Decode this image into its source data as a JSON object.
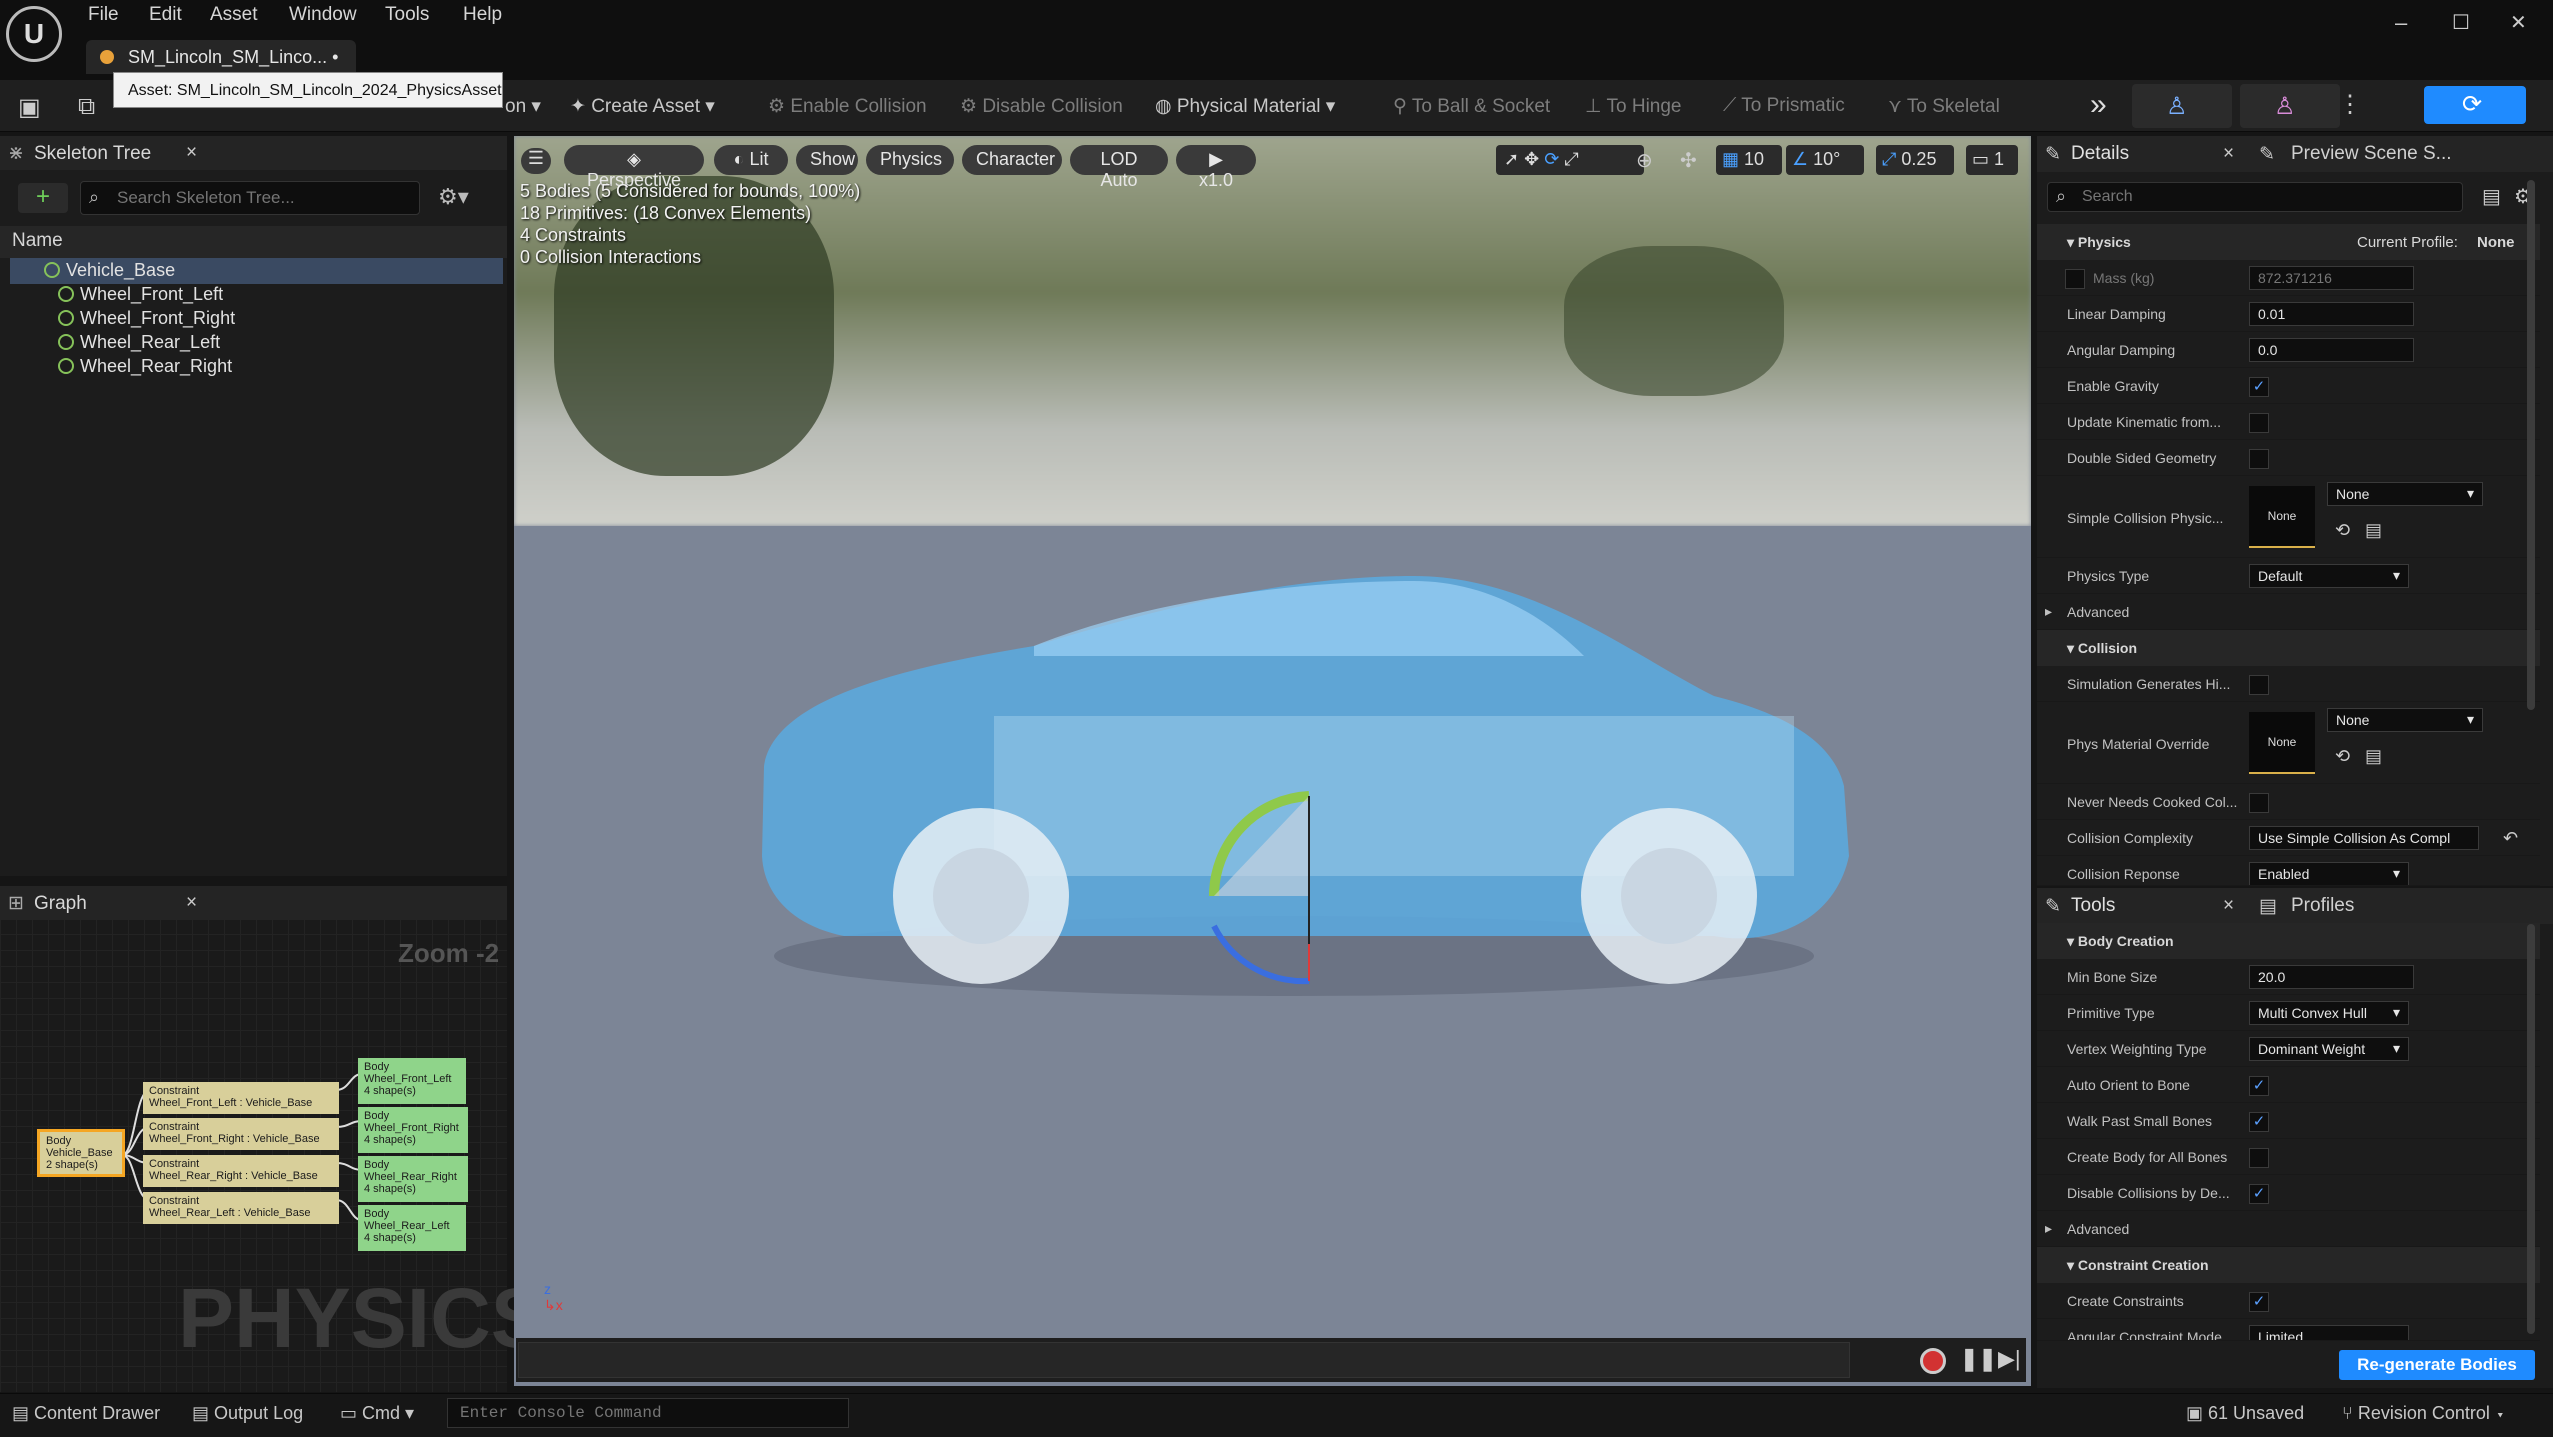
{
  "menu": {
    "file": "File",
    "edit": "Edit",
    "asset": "Asset",
    "window": "Window",
    "tools": "Tools",
    "help": "Help"
  },
  "tab": {
    "title": "SM_Lincoln_SM_Linco...",
    "marker": "•",
    "close": "×"
  },
  "tooltip": "Asset: SM_Lincoln_SM_Lincoln_2024_PhysicsAsset",
  "window_controls": {
    "minimize": "–",
    "maximize": "☐",
    "close": "✕"
  },
  "toolbar": {
    "partial_label": "on",
    "create_asset": "Create Asset",
    "enable_collision": "Enable Collision",
    "disable_collision": "Disable Collision",
    "physical_material": "Physical Material",
    "to_ball_socket": "To Ball & Socket",
    "to_hinge": "To Hinge",
    "to_prismatic": "To Prismatic",
    "to_skeletal": "To Skeletal"
  },
  "skeleton": {
    "panel_title": "Skeleton Tree",
    "search_placeholder": "Search Skeleton Tree...",
    "column_name": "Name",
    "bones": [
      "Vehicle_Base",
      "Wheel_Front_Left",
      "Wheel_Front_Right",
      "Wheel_Rear_Left",
      "Wheel_Rear_Right"
    ]
  },
  "graph": {
    "panel_title": "Graph",
    "zoom": "Zoom -2",
    "watermark": "PHYSICS",
    "root": [
      "Body",
      "Vehicle_Base",
      "2 shape(s)"
    ],
    "constraints": [
      [
        "Constraint",
        "Wheel_Front_Left : Vehicle_Base"
      ],
      [
        "Constraint",
        "Wheel_Front_Right : Vehicle_Base"
      ],
      [
        "Constraint",
        "Wheel_Rear_Right : Vehicle_Base"
      ],
      [
        "Constraint",
        "Wheel_Rear_Left : Vehicle_Base"
      ]
    ],
    "bodies": [
      [
        "Body",
        "Wheel_Front_Left",
        "4 shape(s)"
      ],
      [
        "Body",
        "Wheel_Front_Right",
        "4 shape(s)"
      ],
      [
        "Body",
        "Wheel_Rear_Right",
        "4 shape(s)"
      ],
      [
        "Body",
        "Wheel_Rear_Left",
        "4 shape(s)"
      ]
    ]
  },
  "viewport": {
    "perspective": "Perspective",
    "lit": "Lit",
    "show": "Show",
    "physics": "Physics",
    "character": "Character",
    "lod": "LOD Auto",
    "speed": "x1.0",
    "grid": "10",
    "angle": "10°",
    "scale": "0.25",
    "camera": "1",
    "stats": [
      "5 Bodies (5 Considered for bounds, 100%)",
      "18 Primitives: (18 Convex Elements)",
      "4 Constraints",
      "0 Collision Interactions"
    ]
  },
  "details": {
    "panel_title": "Details",
    "preview_tab": "Preview Scene S...",
    "search_placeholder": "Search",
    "physics_section": "Physics",
    "profile_label": "Current Profile:",
    "profile_value": "None",
    "mass_label": "Mass (kg)",
    "mass_value": "872.371216",
    "linear_damping_label": "Linear Damping",
    "linear_damping": "0.01",
    "angular_damping_label": "Angular Damping",
    "angular_damping": "0.0",
    "enable_gravity": "Enable Gravity",
    "update_kinematic": "Update Kinematic from...",
    "double_sided": "Double Sided Geometry",
    "simple_collision": "Simple Collision Physic...",
    "thumb_none": "None",
    "select_none": "None",
    "physics_type_label": "Physics Type",
    "physics_type": "Default",
    "advanced": "Advanced",
    "collision_section": "Collision",
    "sim_generates_hit": "Simulation Generates Hi...",
    "phys_material_override": "Phys Material Override",
    "never_needs_cooked": "Never Needs Cooked Col...",
    "collision_complexity_label": "Collision Complexity",
    "collision_complexity": "Use Simple Collision As Compl",
    "collision_response_label": "Collision Reponse",
    "collision_response": "Enabled"
  },
  "tools": {
    "panel_title": "Tools",
    "profiles_tab": "Profiles",
    "body_creation": "Body Creation",
    "min_bone_size_label": "Min Bone Size",
    "min_bone_size": "20.0",
    "primitive_type_label": "Primitive Type",
    "primitive_type": "Multi Convex Hull",
    "vertex_weighting_label": "Vertex Weighting Type",
    "vertex_weighting": "Dominant Weight",
    "auto_orient": "Auto Orient to Bone",
    "walk_past": "Walk Past Small Bones",
    "create_body_all": "Create Body for All Bones",
    "disable_collisions": "Disable Collisions by De...",
    "advanced": "Advanced",
    "constraint_creation": "Constraint Creation",
    "create_constraints": "Create Constraints",
    "angular_mode_label": "Angular Constraint Mode",
    "angular_mode": "Limited",
    "regenerate": "Re-generate Bodies"
  },
  "statusbar": {
    "content_drawer": "Content Drawer",
    "output_log": "Output Log",
    "cmd": "Cmd",
    "console_placeholder": "Enter Console Command",
    "unsaved": "61 Unsaved",
    "revision_control": "Revision Control"
  },
  "colors": {
    "accent": "#1f8bff",
    "constraint_node": "#d8cf9a",
    "body_node": "#8fd48a",
    "selected_border": "#f5a623"
  }
}
